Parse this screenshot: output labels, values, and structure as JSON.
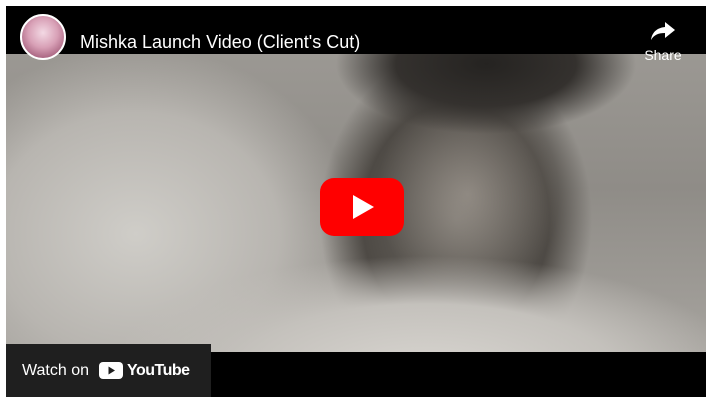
{
  "player": {
    "title": "Mishka Launch Video (Client's Cut)",
    "share_label": "Share",
    "watch_on_label": "Watch on",
    "brand_label": "YouTube",
    "icons": {
      "avatar": "channel-avatar",
      "share": "share-arrow-icon",
      "play": "play-button-icon",
      "youtube": "youtube-logo-icon"
    },
    "colors": {
      "play_button": "#ff0000",
      "bar_background": "#000000",
      "watch_badge": "#1f1f1f"
    }
  }
}
